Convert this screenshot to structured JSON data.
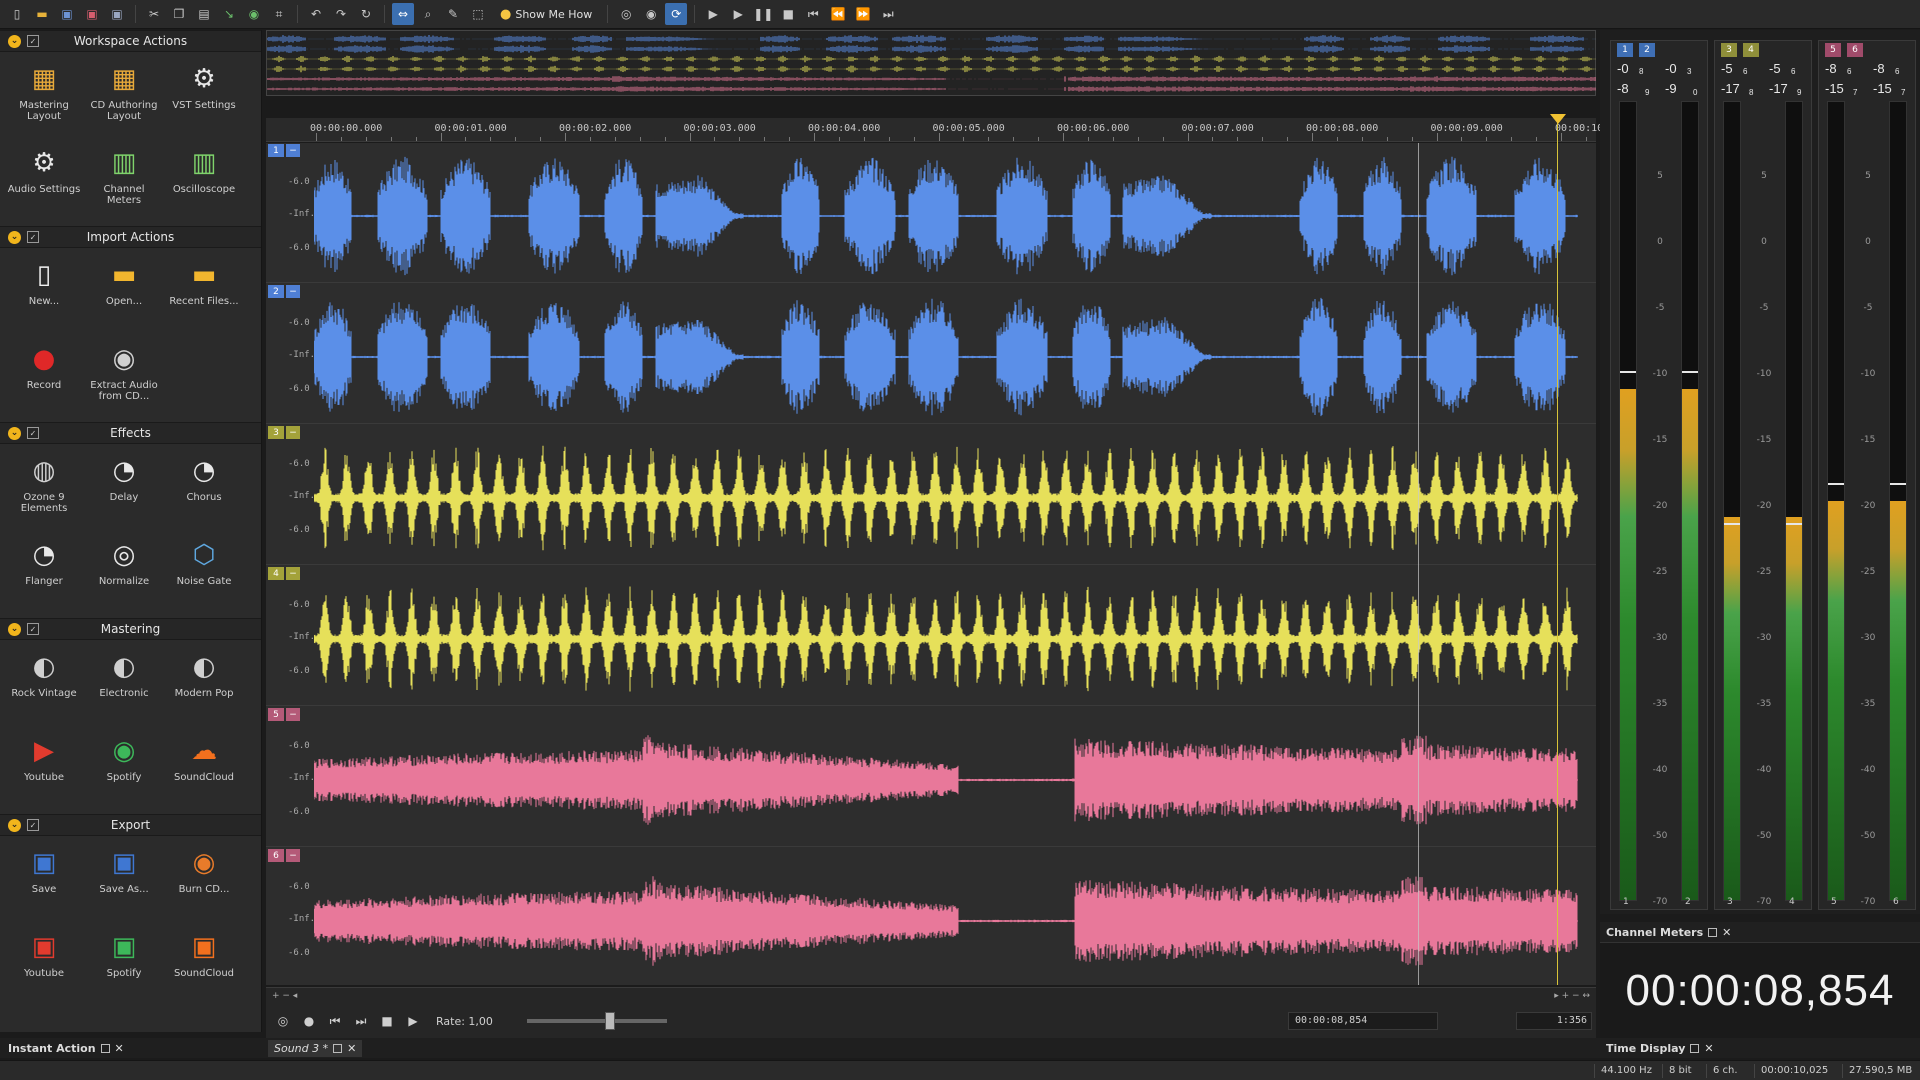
{
  "toolbar": {
    "show_me_how": "Show Me How",
    "icons": [
      "new-icon",
      "open-icon",
      "save-icon",
      "save-all-icon",
      "save-as-icon",
      "cut-icon",
      "copy-icon",
      "paste-icon",
      "mix-paste-icon",
      "trim-icon",
      "crop-icon",
      "undo-icon",
      "redo-icon",
      "repeat-icon",
      "select-tool-icon",
      "zoom-tool-icon",
      "pencil-tool-icon",
      "region-tool-icon",
      "record-monitor-icon",
      "record-icon",
      "loop-icon",
      "play-icon",
      "play-from-start-icon",
      "pause-icon",
      "stop-icon",
      "go-to-start-icon",
      "rewind-icon",
      "fast-forward-icon",
      "go-to-end-icon"
    ]
  },
  "sections": [
    {
      "title": "Workspace Actions",
      "items": [
        {
          "label": "Mastering Layout",
          "icon": "layout-grid-icon"
        },
        {
          "label": "CD Authoring Layout",
          "icon": "layout-grid-icon"
        },
        {
          "label": "VST Settings",
          "icon": "gear-icon"
        },
        {
          "label": "Audio Settings",
          "icon": "gear-icon"
        },
        {
          "label": "Channel Meters",
          "icon": "meters-icon"
        },
        {
          "label": "Oscilloscope",
          "icon": "oscilloscope-icon"
        }
      ]
    },
    {
      "title": "Import Actions",
      "items": [
        {
          "label": "New...",
          "icon": "document-icon"
        },
        {
          "label": "Open...",
          "icon": "folder-icon"
        },
        {
          "label": "Recent Files...",
          "icon": "recent-folder-icon"
        },
        {
          "label": "Record",
          "icon": "record-icon"
        },
        {
          "label": "Extract Audio from CD...",
          "icon": "cd-extract-icon"
        }
      ]
    },
    {
      "title": "Effects",
      "items": [
        {
          "label": "Ozone 9 Elements",
          "icon": "ozone-knob-icon"
        },
        {
          "label": "Delay",
          "icon": "knob-icon"
        },
        {
          "label": "Chorus",
          "icon": "knob-icon"
        },
        {
          "label": "Flanger",
          "icon": "knob-icon"
        },
        {
          "label": "Normalize",
          "icon": "normalize-icon"
        },
        {
          "label": "Noise Gate",
          "icon": "noise-gate-icon"
        }
      ]
    },
    {
      "title": "Mastering",
      "items": [
        {
          "label": "Rock Vintage",
          "icon": "dial-icon"
        },
        {
          "label": "Electronic",
          "icon": "dial-icon"
        },
        {
          "label": "Modern Pop",
          "icon": "dial-icon"
        },
        {
          "label": "Youtube",
          "icon": "youtube-icon"
        },
        {
          "label": "Spotify",
          "icon": "spotify-icon"
        },
        {
          "label": "SoundCloud",
          "icon": "soundcloud-icon"
        }
      ]
    },
    {
      "title": "Export",
      "items": [
        {
          "label": "Save",
          "icon": "floppy-icon"
        },
        {
          "label": "Save As...",
          "icon": "floppy-icon"
        },
        {
          "label": "Burn CD...",
          "icon": "burn-cd-icon"
        },
        {
          "label": "Youtube",
          "icon": "youtube-floppy-icon"
        },
        {
          "label": "Spotify",
          "icon": "spotify-floppy-icon"
        },
        {
          "label": "SoundCloud",
          "icon": "soundcloud-floppy-icon"
        }
      ]
    }
  ],
  "ruler": {
    "labels": [
      "00:00:00.000",
      "00:00:01.000",
      "00:00:02.000",
      "00:00:03.000",
      "00:00:04.000",
      "00:00:05.000",
      "00:00:06.000",
      "00:00:07.000",
      "00:00:08.000",
      "00:00:09.000",
      "00:00:10"
    ]
  },
  "tracks": [
    {
      "num": "1",
      "color": "#5b8fe8",
      "db": [
        "-6.0",
        "-Inf.",
        "-6.0"
      ]
    },
    {
      "num": "2",
      "color": "#5b8fe8",
      "db": [
        "-6.0",
        "-Inf.",
        "-6.0"
      ]
    },
    {
      "num": "3",
      "color": "#e6e05a",
      "db": [
        "-6.0",
        "-Inf.",
        "-6.0"
      ]
    },
    {
      "num": "4",
      "color": "#e6e05a",
      "db": [
        "-6.0",
        "-Inf.",
        "-6.0"
      ]
    },
    {
      "num": "5",
      "color": "#e8789a",
      "db": [
        "-6.0",
        "-Inf.",
        "-6.0"
      ]
    },
    {
      "num": "6",
      "color": "#e8789a",
      "db": [
        "-6.0",
        "-Inf.",
        "-6.0"
      ]
    }
  ],
  "playhead_fraction": 0.8854,
  "transport": {
    "rate_label": "Rate: 1,00",
    "position": "00:00:08,854",
    "zoom": "1:356"
  },
  "meters": {
    "groups": [
      {
        "chips": [
          "1",
          "2"
        ],
        "chip_color": "#3f6fb5",
        "peaks_top": [
          "-0",
          "-0"
        ],
        "peaks_top_sub": [
          "8",
          "3"
        ],
        "peaks_bot": [
          "-8",
          "-9"
        ],
        "peaks_bot_sub": [
          "9",
          "0"
        ],
        "channels": [
          "1",
          "2"
        ],
        "levels": [
          0.64,
          0.64
        ],
        "holds": [
          0.66,
          0.66
        ]
      },
      {
        "chips": [
          "3",
          "4"
        ],
        "chip_color": "#8f8f3a",
        "peaks_top": [
          "-5",
          "-5"
        ],
        "peaks_top_sub": [
          "6",
          "6"
        ],
        "peaks_bot": [
          "-17",
          "-17"
        ],
        "peaks_bot_sub": [
          "8",
          "9"
        ],
        "channels": [
          "3",
          "4"
        ],
        "levels": [
          0.48,
          0.48
        ],
        "holds": [
          0.47,
          0.47
        ]
      },
      {
        "chips": [
          "5",
          "6"
        ],
        "chip_color": "#a04b6a",
        "peaks_top": [
          "-8",
          "-8"
        ],
        "peaks_top_sub": [
          "6",
          "6"
        ],
        "peaks_bot": [
          "-15",
          "-15"
        ],
        "peaks_bot_sub": [
          "7",
          "7"
        ],
        "channels": [
          "5",
          "6"
        ],
        "levels": [
          0.5,
          0.5
        ],
        "holds": [
          0.52,
          0.52
        ]
      }
    ],
    "scale": [
      "5",
      "0",
      "-5",
      "-10",
      "-15",
      "-20",
      "-25",
      "-30",
      "-35",
      "-40",
      "-50",
      "-70"
    ]
  },
  "time_display": "00:00:08,854",
  "tabs": {
    "instant_action": "Instant Action",
    "document": "Sound 3 *",
    "channel_meters": "Channel Meters",
    "time_display": "Time Display"
  },
  "status": {
    "sample_rate": "44.100 Hz",
    "bit_depth": "8 bit",
    "channels": "6 ch.",
    "length": "00:00:10,025",
    "size": "27.590,5 MB"
  }
}
